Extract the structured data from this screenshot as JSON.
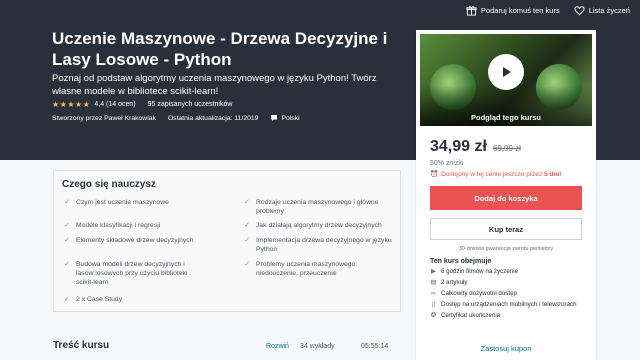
{
  "topbar": {
    "gift_label": "Podaruj komuś ten kurs",
    "wishlist_label": "Lista życzeń"
  },
  "course": {
    "title": "Uczenie Maszynowe - Drzewa Decyzyjne i Lasy Losowe - Python",
    "subtitle": "Poznaj od podstaw algorytmy uczenia maszynowego w języku Python! Twórz własne modele w bibliotece scikit-learn!",
    "stars": "★★★★★",
    "rating": "4,4 (14 ocen)",
    "students": "95 zapisanych uczestników",
    "author": "Stworzony przez Paweł Krakowiak",
    "updated": "Ostatnia aktualizacja: 11/2019",
    "language": "Polski"
  },
  "sidebar": {
    "preview_label": "Podgląd tego kursu",
    "price": "34,99 zł",
    "old_price": "69,99 zł",
    "discount": "50% zniżki",
    "deadline_text": "Dostępny w tej cenie jeszcze przez ",
    "deadline_days": "5 dni!",
    "add_to_cart": "Dodaj do koszyka",
    "buy_now": "Kup teraz",
    "guarantee": "30-dniowa gwarancja zwrotu pieniędzy",
    "includes_title": "Ten kurs obejmuje",
    "includes": [
      {
        "icon": "video-icon",
        "glyph": "▶",
        "text": "6 godzin filmów na życzenie"
      },
      {
        "icon": "article-icon",
        "glyph": "▤",
        "text": "2 artykuły"
      },
      {
        "icon": "infinity-icon",
        "glyph": "∞",
        "text": "Całkowity dożywotni dostęp"
      },
      {
        "icon": "mobile-icon",
        "glyph": "▯",
        "text": "Dostęp na urządzeniach mobilnych i telewizorach"
      },
      {
        "icon": "certificate-icon",
        "glyph": "✪",
        "text": "Certyfikat ukończenia"
      }
    ],
    "coupon": "Zastosuj kupon"
  },
  "learn": {
    "title": "Czego się nauczysz",
    "items": [
      "Czym jest uczenie maszynowe",
      "Rodzaje uczenia maszynowego i główne problemy",
      "Modele klasyfikacji i regresji",
      "Jak działają algorytmy drzew decyzyjnych",
      "Elementy składowe drzew decyzyjnych",
      "Implementacja drzewa decyzyjnego w języku Python",
      "Budowa modeli drzew decyzyjnych i lasów losowych przy użyciu biblioteki scikit-learn",
      "Problemy uczenia maszynowego: niedouczenie, przeuczenie",
      "2 x Case Study"
    ]
  },
  "content": {
    "title": "Treść kursu",
    "expand_label": "Rozwiń",
    "lectures": "34 wykłady",
    "duration": "05:55:14"
  },
  "colors": {
    "hero_bg": "#29303b",
    "accent_red": "#ec5252",
    "star_gold": "#f4c150",
    "link_teal": "#007791"
  }
}
